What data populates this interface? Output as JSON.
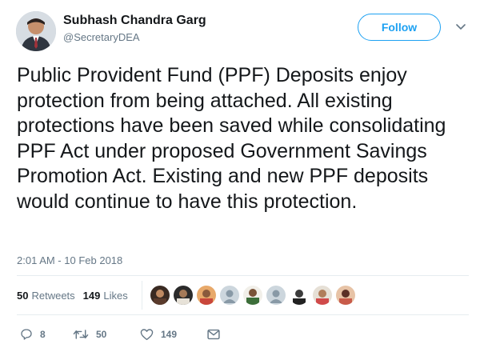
{
  "author": {
    "name": "Subhash Chandra Garg",
    "handle": "@SecretaryDEA",
    "avatar_icon": "profile-photo"
  },
  "follow_button": {
    "label": "Follow",
    "color": "#1da1f2"
  },
  "menu": {
    "icon": "chevron-down-icon"
  },
  "tweet": {
    "text": "Public Provident Fund (PPF) Deposits enjoy protection from being attached. All existing protections have been saved while consolidating PPF Act under proposed Government Savings Promotion Act. Existing and new PPF deposits would continue to have this protection.",
    "timestamp": "2:01 AM - 10 Feb 2018"
  },
  "stats": {
    "retweets_count": "50",
    "retweets_label": "Retweets",
    "likes_count": "149",
    "likes_label": "Likes"
  },
  "likers": [
    {
      "icon": "liker-avatar"
    },
    {
      "icon": "liker-avatar"
    },
    {
      "icon": "liker-avatar"
    },
    {
      "icon": "default-avatar"
    },
    {
      "icon": "liker-avatar"
    },
    {
      "icon": "default-avatar"
    },
    {
      "icon": "liker-avatar"
    },
    {
      "icon": "liker-avatar"
    },
    {
      "icon": "liker-avatar"
    }
  ],
  "actions": {
    "reply_count": "8",
    "retweet_count": "50",
    "like_count": "149"
  },
  "colors": {
    "secondary_text": "#657786",
    "primary_text": "#14171a",
    "divider": "#e6ecf0"
  }
}
